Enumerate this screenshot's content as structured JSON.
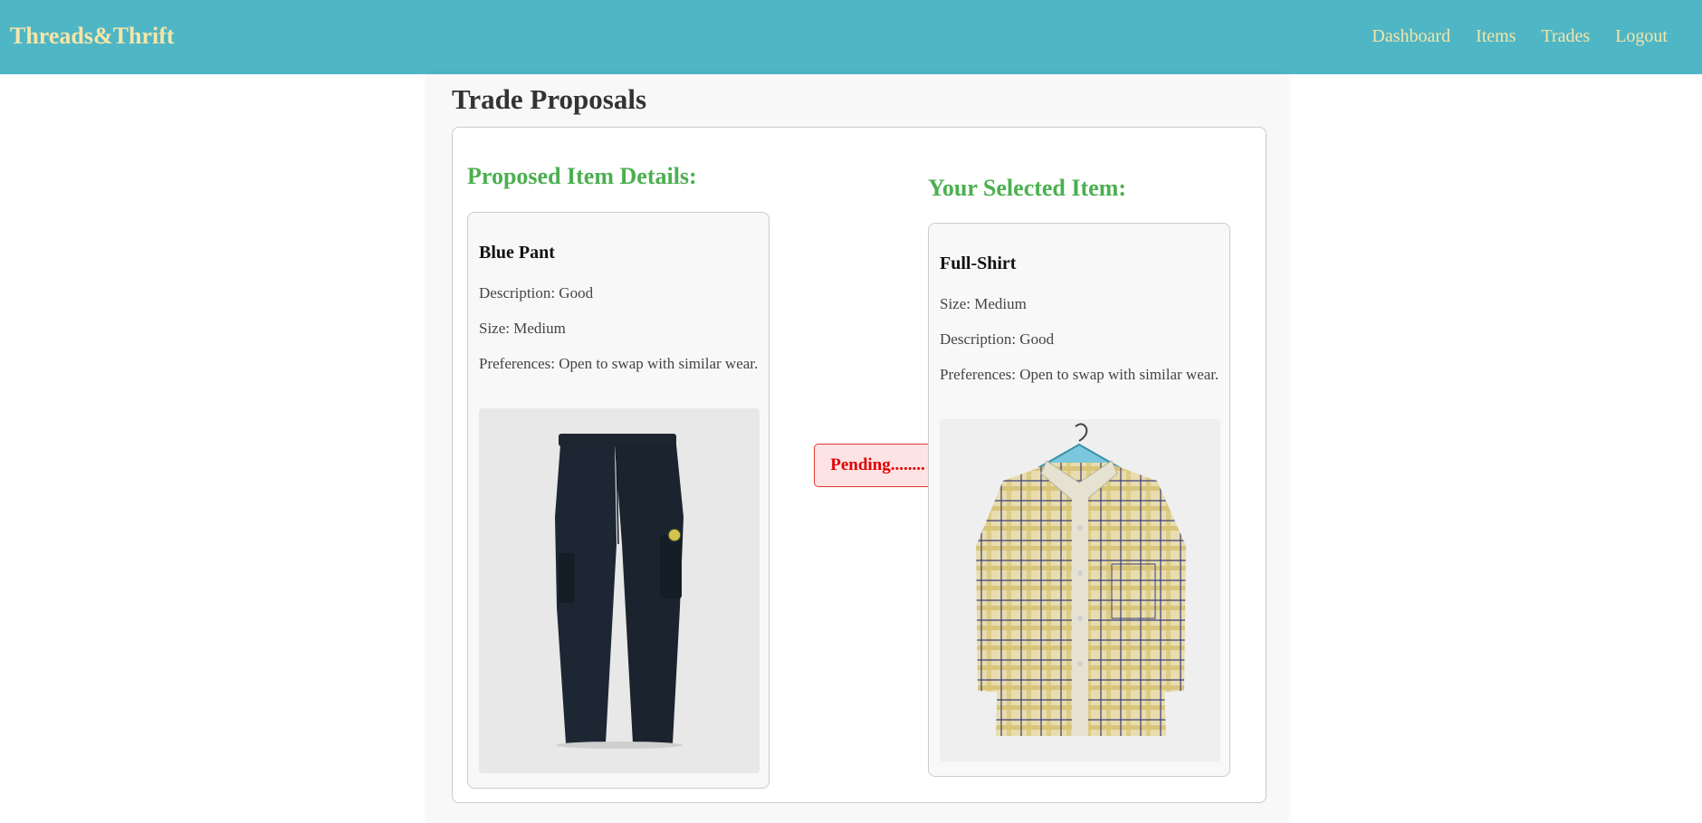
{
  "header": {
    "brand": "Threads&Thrift",
    "nav": [
      "Dashboard",
      "Items",
      "Trades",
      "Logout"
    ]
  },
  "page": {
    "title": "Trade Proposals"
  },
  "trade": {
    "proposed": {
      "heading": "Proposed Item Details:",
      "name": "Blue Pant",
      "lines": [
        "Description: Good",
        "Size: Medium",
        "Preferences: Open to swap with similar wear."
      ],
      "image_icon": "navy-cargo-pants-photo"
    },
    "selected": {
      "heading": "Your Selected Item:",
      "name": "Full-Shirt",
      "lines": [
        "Size: Medium",
        "Description: Good",
        "Preferences: Open to swap with similar wear."
      ],
      "image_icon": "plaid-shirt-on-hanger-photo"
    },
    "status": "Pending........"
  },
  "colors": {
    "navbar": "#4fb6c5",
    "brand_text": "#f5e6a8",
    "heading_green": "#4caf50",
    "pending_red": "#e00000",
    "pending_bg": "#fde3e3"
  }
}
